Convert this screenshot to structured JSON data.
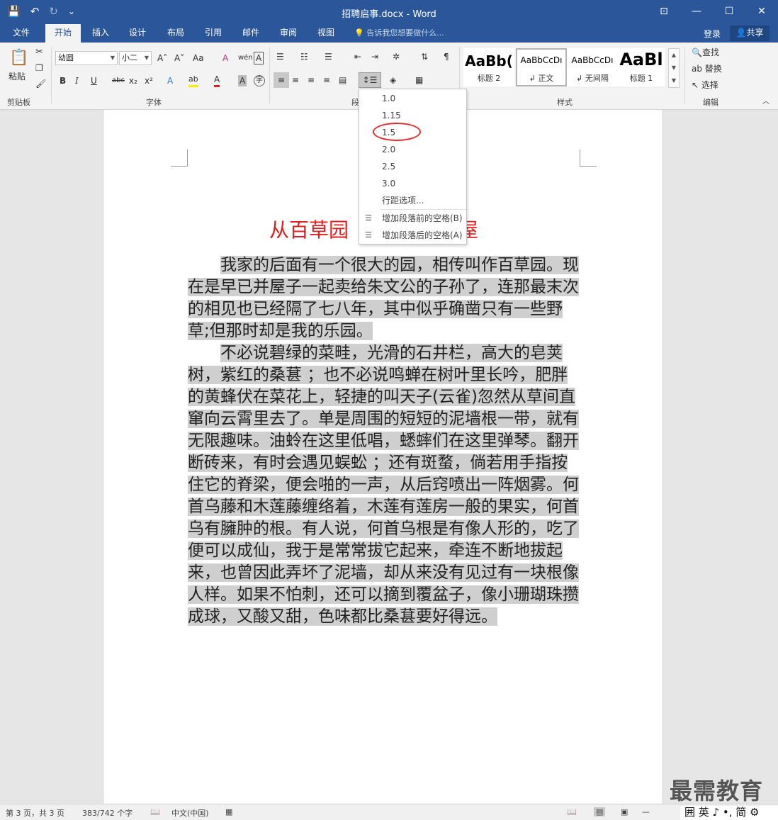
{
  "window": {
    "title": "招聘启事.docx - Word",
    "qat": {
      "save_icon": "💾",
      "undo_icon": "↶",
      "redo_icon": "↻",
      "customize_icon": "⌄"
    },
    "buttons": {
      "ribbon_options": "⊡",
      "minimize": "—",
      "maximize": "☐",
      "close": "✕"
    }
  },
  "tabs": [
    "文件",
    "开始",
    "插入",
    "设计",
    "布局",
    "引用",
    "邮件",
    "审阅",
    "视图"
  ],
  "active_tab": "开始",
  "tell_me": "告诉我您想要做什么...",
  "account": {
    "login": "登录",
    "share": "共享"
  },
  "ribbon": {
    "clipboard": {
      "paste": "粘贴",
      "label": "剪贴板"
    },
    "font": {
      "name": "幼圆",
      "size": "小二",
      "label": "字体",
      "grow": "A˄",
      "shrink": "A˅",
      "change_case": "Aa",
      "clear_format": "A",
      "bold": "B",
      "italic": "I",
      "underline": "U",
      "strike": "abc",
      "sub": "x₂",
      "sup": "x²",
      "phonetic": "wén",
      "char_border": "A",
      "text_effect": "A",
      "highlight": "ab",
      "font_color": "A",
      "char_shading": "A",
      "enclose": "字"
    },
    "paragraph": {
      "label": "段"
    },
    "styles": {
      "label": "样式",
      "items": [
        {
          "sample": "AaBb(",
          "name": "标题 2"
        },
        {
          "sample": "AaBbCcDı",
          "name": "↲ 正文"
        },
        {
          "sample": "AaBbCcDı",
          "name": "↲ 无间隔"
        },
        {
          "sample": "AaBl",
          "name": "标题 1"
        }
      ]
    },
    "editing": {
      "find": "查找",
      "replace": "替换",
      "select": "选择",
      "label": "编辑"
    }
  },
  "line_spacing_menu": {
    "options": [
      "1.0",
      "1.15",
      "1.5",
      "2.0",
      "2.5",
      "3.0"
    ],
    "more": "行距选项...",
    "add_before": "增加段落前的空格(B)",
    "add_after": "增加段落后的空格(A)"
  },
  "document": {
    "title_visible": "从百草园",
    "title_tail": "屋",
    "paragraphs": [
      "我家的后面有一个很大的园，相传叫作百草园。现在是早已并屋子一起卖给朱文公的子孙了，连那最末次的相见也已经隔了七八年，其中似乎确凿只有一些野草;但那时却是我的乐园。",
      "不必说碧绿的菜畦，光滑的石井栏，高大的皂荚树，紫红的桑葚 ；也不必说鸣蝉在树叶里长吟，肥胖的黄蜂伏在菜花上，轻捷的叫天子(云雀)忽然从草间直窜向云霄里去了。单是周围的短短的泥墙根一带，就有无限趣味。油蛉在这里低唱，蟋蟀们在这里弹琴。翻开断砖来，有时会遇见蜈蚣 ；还有斑蝥，倘若用手指按住它的脊梁，便会啪的一声，从后窍喷出一阵烟雾。何首乌藤和木莲藤缠络着，木莲有莲房一般的果实，何首乌有臃肿的根。有人说，何首乌根是有像人形的，吃了便可以成仙，我于是常常拔它起来，牵连不断地拔起来，也曾因此弄坏了泥墙，却从来没有见过有一块根像人样。如果不怕刺，还可以摘到覆盆子，像小珊瑚珠攒成球，又酸又甜，色味都比桑葚要好得远。"
    ]
  },
  "status": {
    "page": "第 3 页，共 3 页",
    "words": "383/742 个字",
    "language": "中文(中国)"
  },
  "watermark": "最需教育",
  "ime": "囲 英 ♪ •, 简 ⚙"
}
